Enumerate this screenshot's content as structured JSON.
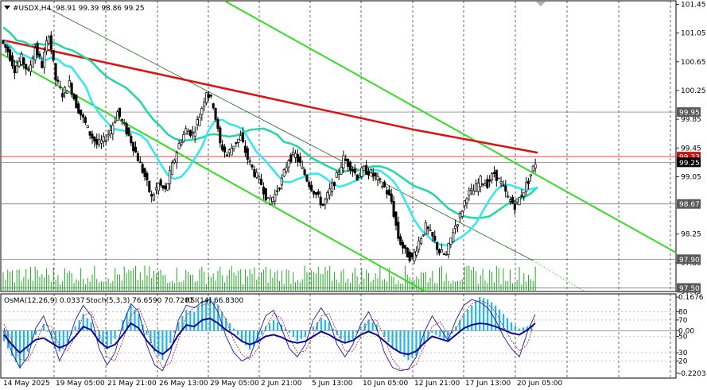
{
  "header": {
    "symbol_label": "#USDX,H4",
    "ohlc": "98.91 99.39 98.86 99.25"
  },
  "indicator_header": {
    "osma": "OsMA(12,26,9) 0.0337",
    "stoch": "Stoch(5,3,3) 76.6590 70.7207",
    "rsi": "RSI(14) 66.8300"
  },
  "colors": {
    "bullish": "#000000",
    "bearish": "#000000",
    "ma_red": "#e01010",
    "ma_green": "#20d8a0",
    "ma_cyan": "#30e8f0",
    "channel": "#33dd22",
    "trendline_dark": "#1e6b1e",
    "volume": "#22aa22",
    "osma_hist": "#1fb6e8",
    "stoch_main": "#1a1aaa",
    "stoch_signal": "#cc2222",
    "rsi": "#0a0a99",
    "grid": "#000000"
  },
  "chart_data": [
    {
      "type": "candlestick",
      "title": "#USDX,H4",
      "ylim": [
        97.45,
        101.5
      ],
      "y_ticks": [
        "101.45",
        "101.05",
        "100.65",
        "100.25",
        "99.85",
        "99.45",
        "99.05",
        "98.25",
        "97.85",
        "97.45"
      ],
      "highlighted_levels": [
        {
          "label": "99.95",
          "value": 99.95,
          "bg": "#5a5a5a"
        },
        {
          "label": "99.33",
          "value": 99.33,
          "bg": "#cc1111"
        },
        {
          "label": "99.25",
          "value": 99.25,
          "bg": "#000000"
        },
        {
          "label": "98.67",
          "value": 98.67,
          "bg": "#5a5a5a"
        },
        {
          "label": "97.90",
          "value": 97.9,
          "bg": "#5a5a5a"
        },
        {
          "label": "97.50",
          "value": 97.5,
          "bg": "#5a5a5a"
        }
      ],
      "x_labels": [
        "14 May 2025",
        "19 May 05:00",
        "21 May 21:00",
        "26 May 13:00",
        "29 May 05:00",
        "2 Jun 21:00",
        "5 Jun 13:00",
        "10 Jun 05:00",
        "12 Jun 21:00",
        "17 Jun 13:00",
        "20 Jun 05:00"
      ],
      "close_path": [
        100.95,
        100.8,
        100.55,
        100.7,
        100.5,
        100.85,
        100.6,
        101.05,
        100.4,
        100.2,
        100.35,
        100.05,
        99.85,
        99.65,
        99.5,
        99.55,
        99.7,
        99.95,
        99.75,
        99.55,
        99.3,
        99.05,
        98.75,
        98.95,
        98.85,
        99.2,
        99.5,
        99.7,
        99.65,
        99.9,
        100.25,
        100.05,
        99.5,
        99.35,
        99.5,
        99.6,
        99.3,
        99.1,
        98.95,
        98.7,
        98.8,
        99.0,
        99.3,
        99.35,
        99.15,
        98.95,
        98.8,
        98.65,
        98.85,
        99.05,
        99.3,
        99.2,
        99.05,
        99.15,
        99.1,
        99.0,
        98.9,
        98.7,
        98.2,
        98.0,
        97.9,
        98.15,
        98.35,
        98.2,
        98.0,
        97.95,
        98.3,
        98.5,
        98.8,
        98.85,
        99.0,
        98.95,
        99.1,
        98.95,
        98.75,
        98.65,
        98.8,
        99.0,
        99.25
      ]
    },
    {
      "type": "indicator",
      "title": "OsMA(12,26,9) / Stoch(5,3,3) / RSI(14)",
      "y_ticks": [
        "0.1676",
        "80",
        "70",
        "0.00",
        "50",
        "30",
        "20",
        "-0.2203"
      ],
      "osma_path": [
        -0.05,
        -0.12,
        -0.18,
        -0.1,
        -0.02,
        0.03,
        -0.04,
        -0.1,
        -0.06,
        0.02,
        0.08,
        0.04,
        -0.05,
        -0.09,
        -0.04,
        0.05,
        0.12,
        0.08,
        -0.02,
        -0.1,
        -0.14,
        -0.06,
        0.04,
        0.1,
        0.09,
        0.14,
        0.16,
        0.12,
        0.06,
        0.01,
        -0.05,
        -0.09,
        -0.06,
        0.02,
        0.05,
        0.03,
        -0.01,
        -0.05,
        -0.03,
        0.02,
        0.06,
        0.04,
        -0.02,
        -0.06,
        -0.04,
        0.02,
        0.05,
        0.03,
        -0.03,
        -0.08,
        -0.11,
        -0.14,
        -0.12,
        -0.06,
        -0.01,
        -0.03,
        -0.05,
        0.02,
        0.08,
        0.12,
        0.16,
        0.15,
        0.12,
        0.08,
        0.04,
        0.01,
        0.02,
        0.03
      ],
      "rsi_path": [
        52,
        40,
        30,
        38,
        46,
        48,
        42,
        36,
        40,
        50,
        62,
        58,
        44,
        36,
        40,
        52,
        66,
        60,
        45,
        34,
        28,
        36,
        52,
        64,
        62,
        70,
        72,
        66,
        58,
        52,
        44,
        40,
        44,
        50,
        52,
        49,
        44,
        42,
        44,
        50,
        56,
        52,
        46,
        42,
        45,
        52,
        56,
        52,
        44,
        36,
        30,
        28,
        32,
        42,
        50,
        47,
        44,
        52,
        60,
        64,
        66,
        65,
        62,
        58,
        54,
        52,
        58,
        66
      ],
      "stoch_main_path": [
        60,
        30,
        12,
        25,
        60,
        75,
        50,
        20,
        40,
        70,
        88,
        75,
        35,
        15,
        30,
        65,
        90,
        80,
        40,
        15,
        8,
        30,
        70,
        88,
        85,
        92,
        95,
        80,
        50,
        30,
        20,
        25,
        50,
        75,
        82,
        60,
        35,
        25,
        40,
        70,
        85,
        70,
        40,
        25,
        40,
        65,
        80,
        60,
        30,
        12,
        8,
        10,
        25,
        55,
        75,
        60,
        45,
        70,
        88,
        95,
        92,
        85,
        70,
        50,
        35,
        25,
        55,
        77
      ],
      "stoch_signal_path": [
        65,
        45,
        22,
        20,
        40,
        65,
        62,
        38,
        32,
        50,
        75,
        80,
        55,
        25,
        20,
        45,
        75,
        85,
        62,
        30,
        12,
        18,
        45,
        75,
        86,
        88,
        92,
        88,
        70,
        45,
        28,
        22,
        35,
        60,
        78,
        72,
        48,
        30,
        32,
        52,
        75,
        78,
        55,
        32,
        32,
        50,
        70,
        70,
        48,
        22,
        10,
        9,
        16,
        38,
        62,
        68,
        52,
        58,
        78,
        90,
        94,
        90,
        80,
        62,
        45,
        32,
        40,
        71
      ]
    }
  ]
}
